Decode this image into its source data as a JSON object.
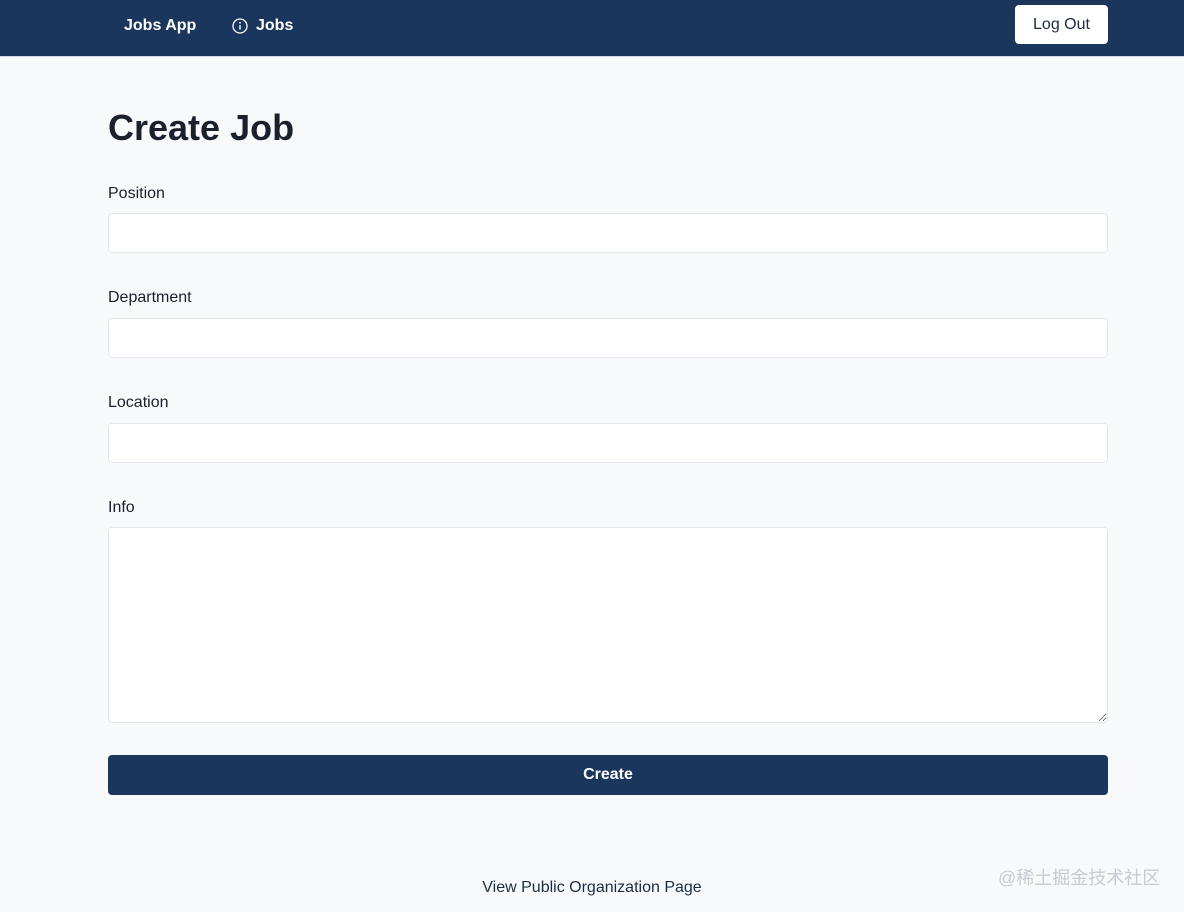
{
  "navbar": {
    "brand": "Jobs App",
    "jobs_link": "Jobs",
    "logout_label": "Log Out",
    "jobs_icon": "info-circle-icon",
    "background": "#1b365d"
  },
  "page": {
    "title": "Create Job"
  },
  "form": {
    "position_label": "Position",
    "position_value": "",
    "department_label": "Department",
    "department_value": "",
    "location_label": "Location",
    "location_value": "",
    "info_label": "Info",
    "info_value": "",
    "submit_label": "Create"
  },
  "footer": {
    "link": "View Public Organization Page"
  },
  "watermark": "@稀土掘金技术社区"
}
